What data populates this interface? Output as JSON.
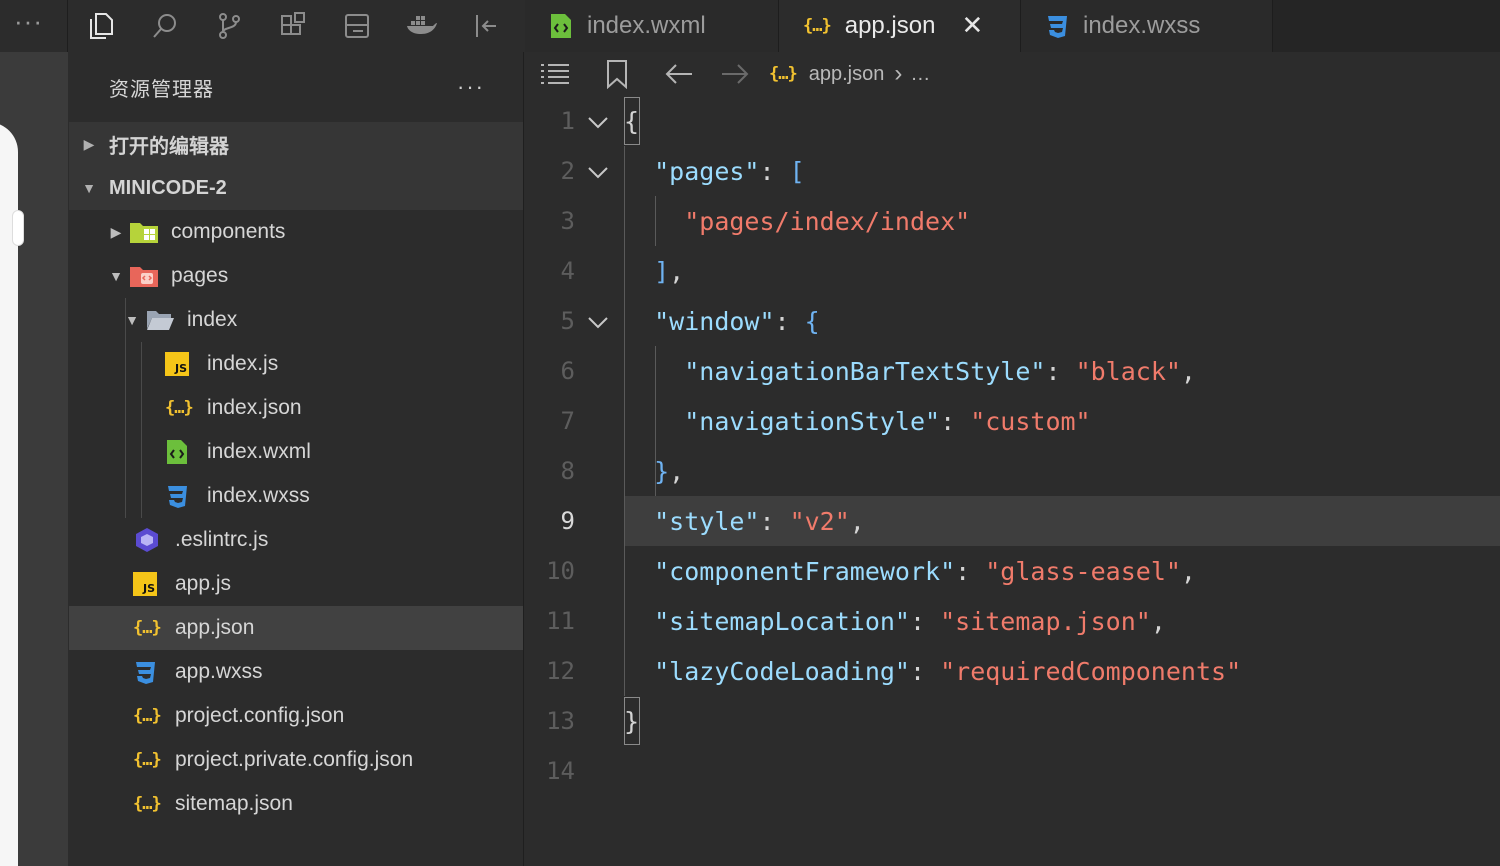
{
  "sidebar": {
    "title": "资源管理器",
    "more": "···",
    "open_editors": "打开的编辑器",
    "project": "MINICODE-2",
    "tree": [
      {
        "label": "components",
        "depth": 0,
        "twisty": "▶",
        "icon": "folder-components-icon"
      },
      {
        "label": "pages",
        "depth": 0,
        "twisty": "▼",
        "icon": "folder-pages-icon"
      },
      {
        "label": "index",
        "depth": 1,
        "twisty": "▼",
        "icon": "folder-open-icon"
      },
      {
        "label": "index.js",
        "depth": 2,
        "twisty": "",
        "icon": "js-icon"
      },
      {
        "label": "index.json",
        "depth": 2,
        "twisty": "",
        "icon": "json-icon"
      },
      {
        "label": "index.wxml",
        "depth": 2,
        "twisty": "",
        "icon": "wxml-icon"
      },
      {
        "label": "index.wxss",
        "depth": 2,
        "twisty": "",
        "icon": "css-icon"
      },
      {
        "label": ".eslintrc.js",
        "depth": 0,
        "twisty": "",
        "icon": "eslint-icon"
      },
      {
        "label": "app.js",
        "depth": 0,
        "twisty": "",
        "icon": "js-icon"
      },
      {
        "label": "app.json",
        "depth": 0,
        "twisty": "",
        "icon": "json-icon",
        "selected": true
      },
      {
        "label": "app.wxss",
        "depth": 0,
        "twisty": "",
        "icon": "css-icon"
      },
      {
        "label": "project.config.json",
        "depth": 0,
        "twisty": "",
        "icon": "json-icon"
      },
      {
        "label": "project.private.config.json",
        "depth": 0,
        "twisty": "",
        "icon": "json-icon"
      },
      {
        "label": "sitemap.json",
        "depth": 0,
        "twisty": "",
        "icon": "json-icon"
      }
    ]
  },
  "tabs": [
    {
      "label": "index.wxml",
      "icon": "wxml-icon",
      "active": false
    },
    {
      "label": "app.json",
      "icon": "json-icon",
      "active": true,
      "close": "✕"
    },
    {
      "label": "index.wxss",
      "icon": "css-icon",
      "active": false
    }
  ],
  "breadcrumb": {
    "file": "app.json",
    "sep": "›",
    "rest": "…"
  },
  "json_glyph": "{…}",
  "js_glyph": "JS",
  "editor": {
    "current_line": 9,
    "lines": [
      {
        "n": "1",
        "tokens": [
          [
            "b",
            "{"
          ]
        ]
      },
      {
        "n": "2",
        "tokens": [
          [
            "p",
            "  "
          ],
          [
            "k",
            "\"pages\""
          ],
          [
            "p",
            ": "
          ],
          [
            "bl",
            "["
          ]
        ]
      },
      {
        "n": "3",
        "tokens": [
          [
            "p",
            "    "
          ],
          [
            "s",
            "\"pages/index/index\""
          ]
        ]
      },
      {
        "n": "4",
        "tokens": [
          [
            "p",
            "  "
          ],
          [
            "bl",
            "]"
          ],
          [
            "p",
            ","
          ]
        ]
      },
      {
        "n": "5",
        "tokens": [
          [
            "p",
            "  "
          ],
          [
            "k",
            "\"window\""
          ],
          [
            "p",
            ": "
          ],
          [
            "bl",
            "{"
          ]
        ]
      },
      {
        "n": "6",
        "tokens": [
          [
            "p",
            "    "
          ],
          [
            "k",
            "\"navigationBarTextStyle\""
          ],
          [
            "p",
            ": "
          ],
          [
            "s",
            "\"black\""
          ],
          [
            "p",
            ","
          ]
        ]
      },
      {
        "n": "7",
        "tokens": [
          [
            "p",
            "    "
          ],
          [
            "k",
            "\"navigationStyle\""
          ],
          [
            "p",
            ": "
          ],
          [
            "s",
            "\"custom\""
          ]
        ]
      },
      {
        "n": "8",
        "tokens": [
          [
            "p",
            "  "
          ],
          [
            "bl",
            "}"
          ],
          [
            "p",
            ","
          ]
        ]
      },
      {
        "n": "9",
        "tokens": [
          [
            "p",
            "  "
          ],
          [
            "k",
            "\"style\""
          ],
          [
            "p",
            ": "
          ],
          [
            "s",
            "\"v2\""
          ],
          [
            "p",
            ","
          ]
        ]
      },
      {
        "n": "10",
        "tokens": [
          [
            "p",
            "  "
          ],
          [
            "k",
            "\"componentFramework\""
          ],
          [
            "p",
            ": "
          ],
          [
            "s",
            "\"glass-easel\""
          ],
          [
            "p",
            ","
          ]
        ]
      },
      {
        "n": "11",
        "tokens": [
          [
            "p",
            "  "
          ],
          [
            "k",
            "\"sitemapLocation\""
          ],
          [
            "p",
            ": "
          ],
          [
            "s",
            "\"sitemap.json\""
          ],
          [
            "p",
            ","
          ]
        ]
      },
      {
        "n": "12",
        "tokens": [
          [
            "p",
            "  "
          ],
          [
            "k",
            "\"lazyCodeLoading\""
          ],
          [
            "p",
            ": "
          ],
          [
            "s",
            "\"requiredComponents\""
          ]
        ]
      },
      {
        "n": "13",
        "tokens": [
          [
            "b",
            "}"
          ]
        ]
      },
      {
        "n": "14",
        "tokens": []
      }
    ],
    "folds": [
      "1",
      "2",
      "5"
    ]
  },
  "colors": {
    "key": "#9cdcfe",
    "string": "#f07b6b",
    "json_icon": "#f2c230",
    "css_icon": "#3b8fe0",
    "wxml_icon": "#6cbf3c",
    "eslint_icon": "#5b4bd1"
  }
}
